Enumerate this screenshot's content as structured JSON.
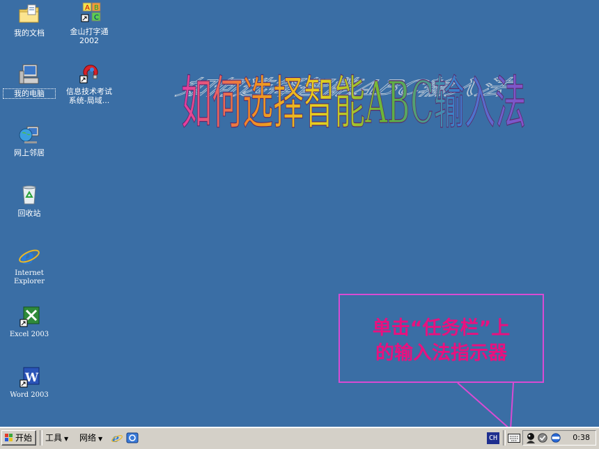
{
  "desktop_icons": [
    {
      "label": "我的文档",
      "icon": "my-documents-folder-icon"
    },
    {
      "label": "金山打字通\n2002",
      "icon": "typing-abc-blocks-icon"
    },
    {
      "label": "我的电脑",
      "icon": "my-computer-icon"
    },
    {
      "label": "信息技术考试\n系统-局域...",
      "icon": "exam-system-magnet-icon"
    },
    {
      "label": "网上邻居",
      "icon": "network-places-icon"
    },
    {
      "label": "回收站",
      "icon": "recycle-bin-icon"
    },
    {
      "label": "Internet\nExplorer",
      "icon": "internet-explorer-icon"
    },
    {
      "label": "Excel 2003",
      "icon": "excel-icon"
    },
    {
      "label": "Word 2003",
      "icon": "word-icon"
    }
  ],
  "wordart_title": "如何选择智能ABC输入法",
  "wordart_colors": [
    "#e23aa6",
    "#f08a24",
    "#e8d21d",
    "#62b43a",
    "#3a7fd0",
    "#8a4fc8"
  ],
  "callout": {
    "line1": "单击“任务栏”上",
    "line2": "的输入法指示器",
    "text_color": "#e8117f",
    "border_color": "#d94bd3"
  },
  "taskbar": {
    "start_label": "开始",
    "tools_label": "工具",
    "network_label": "网络",
    "lang_indicator": "CH",
    "clock": "0:38"
  }
}
